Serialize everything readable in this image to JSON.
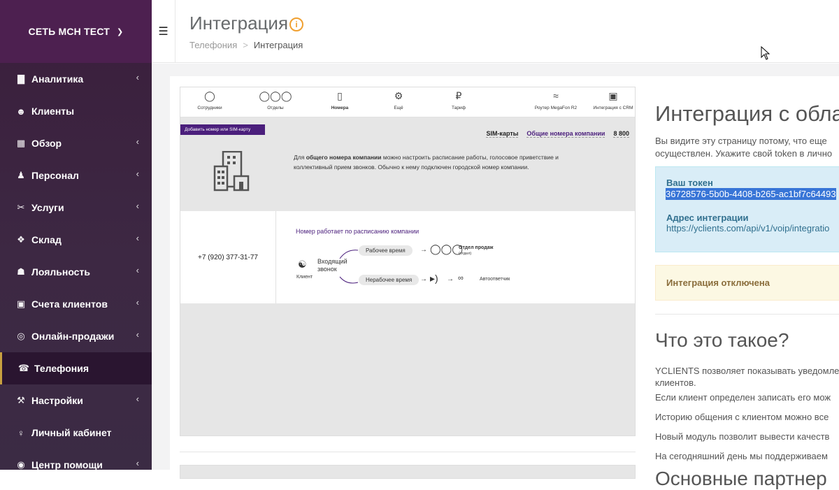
{
  "sidebar": {
    "company": "СЕТЬ МСН ТЕСТ",
    "items": [
      {
        "label": "Аналитика",
        "icon": "bar-chart-icon",
        "arrow": true
      },
      {
        "label": "Клиенты",
        "icon": "users-icon",
        "arrow": false
      },
      {
        "label": "Обзор",
        "icon": "grid-icon",
        "arrow": true
      },
      {
        "label": "Персонал",
        "icon": "user-icon",
        "arrow": true
      },
      {
        "label": "Услуги",
        "icon": "scissors-icon",
        "arrow": true
      },
      {
        "label": "Склад",
        "icon": "cubes-icon",
        "arrow": true
      },
      {
        "label": "Лояльность",
        "icon": "gift-icon",
        "arrow": true
      },
      {
        "label": "Счета клиентов",
        "icon": "briefcase-icon",
        "arrow": true
      },
      {
        "label": "Онлайн-продажи",
        "icon": "globe-icon",
        "arrow": true
      },
      {
        "label": "Телефония",
        "icon": "phone-icon",
        "arrow": false,
        "active": true
      },
      {
        "label": "Настройки",
        "icon": "wrench-icon",
        "arrow": true
      },
      {
        "label": "Личный кабинет",
        "icon": "person-icon",
        "arrow": false
      },
      {
        "label": "Центр помощи",
        "icon": "lifebuoy-icon",
        "arrow": true
      }
    ]
  },
  "header": {
    "title": "Интеграция",
    "breadcrumb": [
      "Телефония",
      "Интеграция"
    ]
  },
  "mock": {
    "tabs": [
      "Сотрудники",
      "Отделы",
      "Номера",
      "Ещё",
      "Тариф",
      "Роутер MegaFon R2",
      "Интеграция с CRM"
    ],
    "add_button": "Добавить номер или SIM-карту",
    "links": [
      "SIM-карты",
      "Общие номера компании",
      "8 800"
    ],
    "desc_pre": "Для ",
    "desc_bold": "общего номера компании",
    "desc_post": " можно настроить расписание работы, голосовое приветствие и коллективный прием звонков. Обычно к нему подключен городской номер компании.",
    "phone": "+7 (920) 377-31-77",
    "schedule_title": "Номер работает по расписанию компании",
    "incoming": "Входящий звонок",
    "client": "Клиент",
    "work_time": "Рабочее время",
    "off_time": "Нерабочее время",
    "dept": "Отдел продаж",
    "dept_sub": "(отдел)",
    "answering": "Автоответчик"
  },
  "integration": {
    "title": "Интеграция с обла",
    "desc_line1": "Вы видите эту страницу потому, что еще",
    "desc_line2": "осуществлен. Укажите свой token в лично",
    "token_label": "Ваш токен",
    "token_value": "36728576-5b0b-4408-b265-ac1bf7c64493",
    "address_label": "Адрес интеграции",
    "address_value": "https://yclients.com/api/v1/voip/integratio",
    "status": "Интеграция отключена",
    "what_title": "Что это такое?",
    "p1_line1": "YCLIENTS позволяет показывать уведомле",
    "p1_line2": "клиентов.",
    "p2": "Если клиент определен записать его мож",
    "p3": "Историю общения с клиентом можно все",
    "p4": "Новый модуль позволит вывести качеств",
    "p5": "На сегодняшний день мы поддерживаем",
    "partners_title": "Основные партнер"
  }
}
